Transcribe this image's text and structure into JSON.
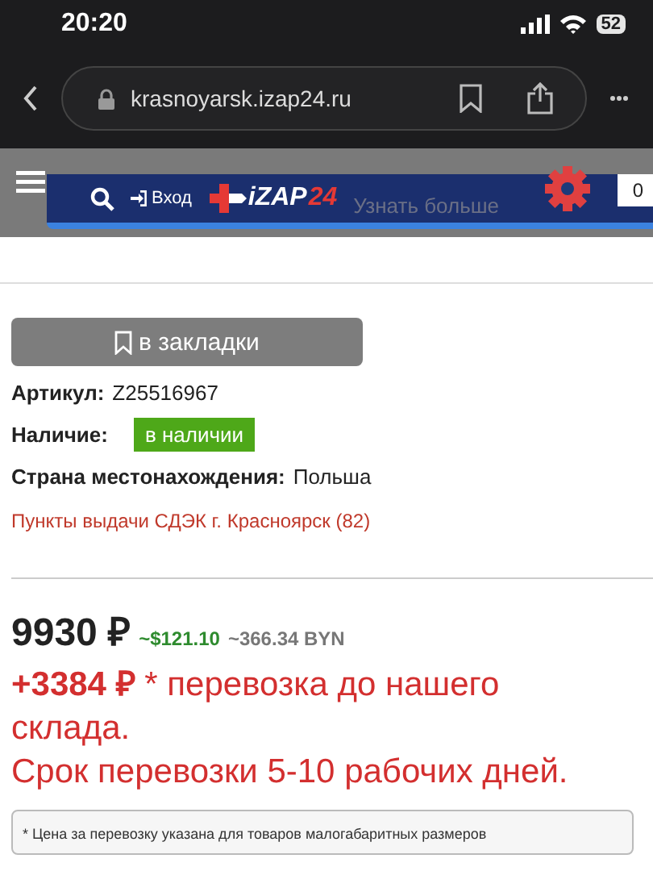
{
  "status_bar": {
    "time": "20:20",
    "battery": "52"
  },
  "browser": {
    "url": "krasnoyarsk.izap24.ru"
  },
  "header": {
    "login": "Вход",
    "logo_main": "iZAP",
    "logo_accent": "24",
    "banner_text": "Узнать больше",
    "cart_count": "0"
  },
  "bookmark_button": "в закладки",
  "details": [
    {
      "label": "Артикул:",
      "value": "Z25516967",
      "kind": "text"
    },
    {
      "label": "Наличие:",
      "value": "в наличии",
      "kind": "badge"
    },
    {
      "label": "Страна местонахождения:",
      "value": "Польша",
      "kind": "text"
    }
  ],
  "pickup_link": "Пункты выдачи СДЭК г. Красноярск (82)",
  "price": {
    "main": "9930 ₽",
    "usd": "~$121.10",
    "byn": "~366.34 BYN"
  },
  "shipping": {
    "extra": "+3384 ₽",
    "note": "* перевозка до нашего склада.",
    "term": "Срок перевозки 5-10 рабочих дней."
  },
  "footnote": "* Цена за перевозку указана для товаров малогабаритных размеров"
}
